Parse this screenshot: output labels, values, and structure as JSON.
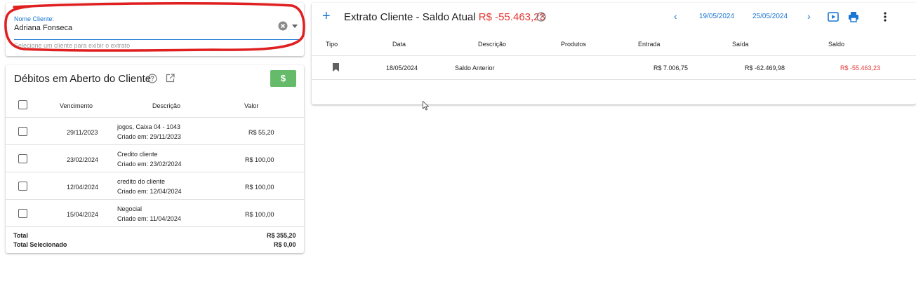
{
  "client": {
    "label": "Nome Cliente:",
    "value": "Adriana Fonseca",
    "hint": "Selecione um cliente para exibir o extrato"
  },
  "debts": {
    "title": "Débitos em Aberto do Cliente",
    "button_label": "$",
    "headers": {
      "due": "Vencimento",
      "desc": "Descrição",
      "value": "Valor"
    },
    "rows": [
      {
        "due": "29/11/2023",
        "desc": "jogos, Caixa 04 - 1043",
        "created": "Criado em: 29/11/2023",
        "value": "R$ 55,20"
      },
      {
        "due": "23/02/2024",
        "desc": "Credito cliente",
        "created": "Criado em: 23/02/2024",
        "value": "R$ 100,00"
      },
      {
        "due": "12/04/2024",
        "desc": "credito do cliente",
        "created": "Criado em: 12/04/2024",
        "value": "R$ 100,00"
      },
      {
        "due": "15/04/2024",
        "desc": "Negocial",
        "created": "Criado em: 11/04/2024",
        "value": "R$ 100,00"
      }
    ],
    "total_label": "Total",
    "total_value": "R$ 355,20",
    "selected_label": "Total Selecionado",
    "selected_value": "R$ 0,00"
  },
  "statement": {
    "title": "Extrato Cliente - Saldo Atual",
    "balance": "R$ -55.463,23",
    "date_from": "19/05/2024",
    "date_to": "25/05/2024",
    "headers": {
      "type": "Tipo",
      "date": "Data",
      "desc": "Descrição",
      "products": "Produtos",
      "in": "Entrada",
      "out": "Saída",
      "balance": "Saldo"
    },
    "row": {
      "date": "18/05/2024",
      "desc": "Saldo Anterior",
      "in": "R$ 7.006,75",
      "out": "R$ -62.469,98",
      "balance": "R$ -55.463,23"
    }
  },
  "colors": {
    "accent": "#1976d2",
    "negative": "#e53935",
    "success": "#66bb6a",
    "annotation": "#e02020"
  },
  "icons": [
    "clear-icon",
    "dropdown-icon",
    "help-icon",
    "external-link-icon",
    "plus-icon",
    "chevron-left-icon",
    "chevron-right-icon",
    "slideshow-icon",
    "print-icon",
    "more-vert-icon",
    "bookmark-icon"
  ]
}
